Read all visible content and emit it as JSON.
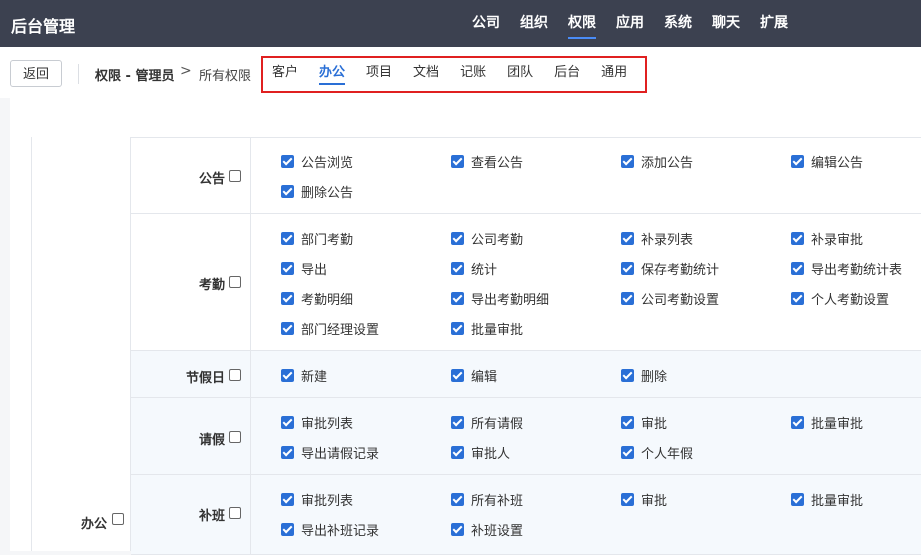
{
  "app": {
    "title": "后台管理"
  },
  "topnav": [
    {
      "label": "公司",
      "active": false
    },
    {
      "label": "组织",
      "active": false
    },
    {
      "label": "权限",
      "active": true
    },
    {
      "label": "应用",
      "active": false
    },
    {
      "label": "系统",
      "active": false
    },
    {
      "label": "聊天",
      "active": false
    },
    {
      "label": "扩展",
      "active": false
    }
  ],
  "subbar": {
    "back_label": "返回",
    "breadcrumb": "权限 - 管理员",
    "breadcrumb_sep": ">",
    "breadcrumb_current": "所有权限",
    "tabs": [
      {
        "label": "客户",
        "active": false
      },
      {
        "label": "办公",
        "active": true
      },
      {
        "label": "项目",
        "active": false
      },
      {
        "label": "文档",
        "active": false
      },
      {
        "label": "记账",
        "active": false
      },
      {
        "label": "团队",
        "active": false
      },
      {
        "label": "后台",
        "active": false
      },
      {
        "label": "通用",
        "active": false
      }
    ]
  },
  "group": {
    "label": "办公",
    "checked": false
  },
  "sections": [
    {
      "title": "公告",
      "checked": false,
      "perms": [
        [
          "公告浏览",
          "查看公告",
          "添加公告",
          "编辑公告"
        ],
        [
          "删除公告"
        ]
      ]
    },
    {
      "title": "考勤",
      "checked": false,
      "perms": [
        [
          "部门考勤",
          "公司考勤",
          "补录列表",
          "补录审批"
        ],
        [
          "导出",
          "统计",
          "保存考勤统计",
          "导出考勤统计表"
        ],
        [
          "考勤明细",
          "导出考勤明细",
          "公司考勤设置",
          "个人考勤设置"
        ],
        [
          "部门经理设置",
          "批量审批"
        ]
      ]
    },
    {
      "title": "节假日",
      "checked": false,
      "perms": [
        [
          "新建",
          "编辑",
          "删除"
        ]
      ]
    },
    {
      "title": "请假",
      "checked": false,
      "perms": [
        [
          "审批列表",
          "所有请假",
          "审批",
          "批量审批"
        ],
        [
          "导出请假记录",
          "审批人",
          "个人年假"
        ]
      ]
    },
    {
      "title": "补班",
      "checked": false,
      "perms": [
        [
          "审批列表",
          "所有补班",
          "审批",
          "批量审批"
        ],
        [
          "导出补班记录",
          "补班设置"
        ]
      ]
    }
  ]
}
